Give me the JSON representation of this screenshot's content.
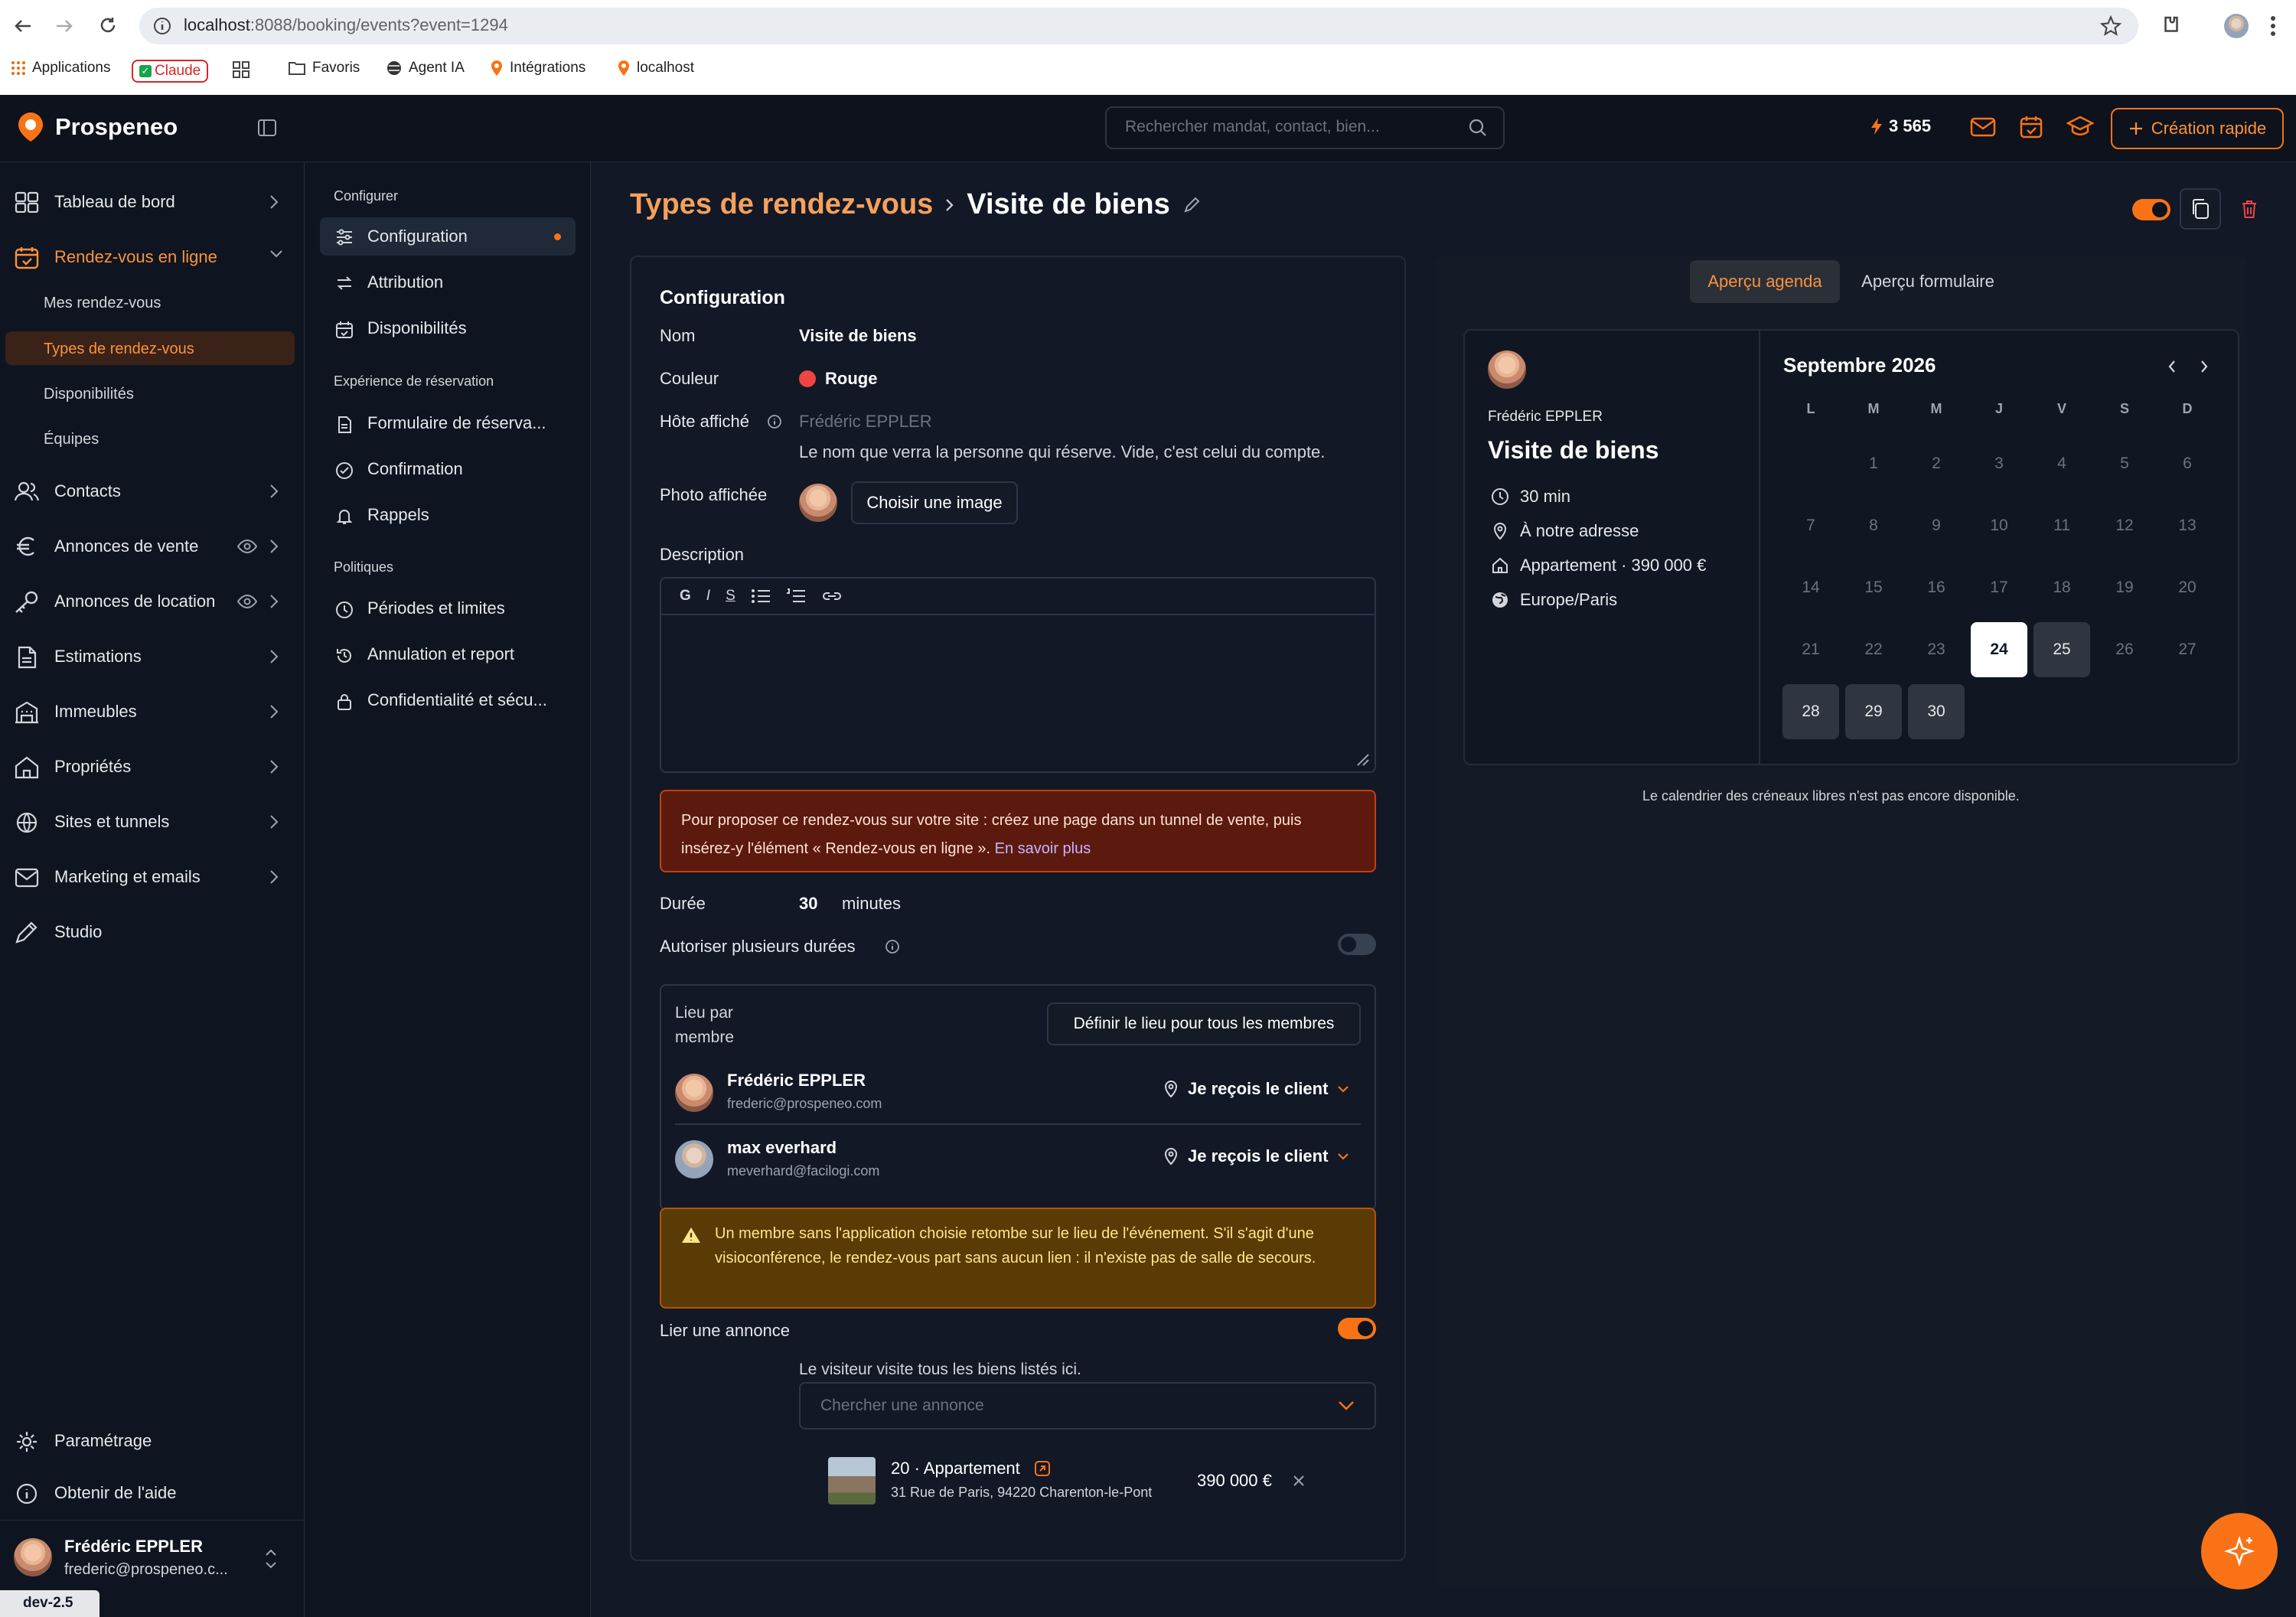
{
  "browser": {
    "url_host": "localhost",
    "url_path": ":8088/booking/events?event=1294",
    "bookmarks": [
      "Applications",
      "Claude",
      "Favoris",
      "Agent IA",
      "Intégrations",
      "localhost"
    ]
  },
  "app": {
    "name": "Prospeneo",
    "search_placeholder": "Rechercher mandat, contact, bien...",
    "credits": "3 565",
    "quick_create": "Création rapide",
    "accent": "#f97316"
  },
  "sidebar": {
    "items": [
      {
        "label": "Tableau de bord",
        "icon": "dashboard-icon"
      },
      {
        "label": "Rendez-vous en ligne",
        "icon": "calendar-icon"
      },
      {
        "label": "Contacts",
        "icon": "contacts-icon"
      },
      {
        "label": "Annonces de vente",
        "icon": "euro-icon"
      },
      {
        "label": "Annonces de location",
        "icon": "key-icon"
      },
      {
        "label": "Estimations",
        "icon": "document-icon"
      },
      {
        "label": "Immeubles",
        "icon": "building-icon"
      },
      {
        "label": "Propriétés",
        "icon": "home-icon"
      },
      {
        "label": "Sites et tunnels",
        "icon": "globe-icon"
      },
      {
        "label": "Marketing et emails",
        "icon": "mail-icon"
      },
      {
        "label": "Studio",
        "icon": "pen-icon"
      }
    ],
    "subitems": [
      "Mes rendez-vous",
      "Types de rendez-vous",
      "Disponibilités",
      "Équipes"
    ],
    "settings": "Paramétrage",
    "help": "Obtenir de l'aide",
    "user_name": "Frédéric EPPLER",
    "user_email": "frederic@prospeneo.c...",
    "version": "dev-2.5"
  },
  "subnav": {
    "section1": "Configurer",
    "section2": "Expérience de réservation",
    "section3": "Politiques",
    "items": [
      "Configuration",
      "Attribution",
      "Disponibilités",
      "Formulaire de réserva...",
      "Confirmation",
      "Rappels",
      "Périodes et limites",
      "Annulation et report",
      "Confidentialité et sécu..."
    ]
  },
  "breadcrumb": {
    "parent": "Types de rendez-vous",
    "current": "Visite de biens"
  },
  "config": {
    "title": "Configuration",
    "name_label": "Nom",
    "name_value": "Visite de biens",
    "color_label": "Couleur",
    "color_value": "Rouge",
    "color_hex": "#ef4444",
    "host_label": "Hôte affiché",
    "host_placeholder": "Frédéric EPPLER",
    "host_help": "Le nom que verra la personne qui réserve. Vide, c'est celui du compte.",
    "photo_label": "Photo affichée",
    "photo_button": "Choisir une image",
    "description_label": "Description",
    "editor_buttons": [
      "G",
      "I",
      "S"
    ],
    "alert_text": "Pour proposer ce rendez-vous sur votre site : créez une page dans un tunnel de vente, puis insérez-y l'élément « Rendez-vous en ligne ».",
    "alert_link": "En savoir plus",
    "duration_label": "Durée",
    "duration_value": "30",
    "duration_unit": "minutes",
    "multi_duration_label": "Autoriser plusieurs durées",
    "multi_duration_on": false,
    "location_label": "Lieu par membre",
    "location_button": "Définir le lieu pour tous les membres",
    "members": [
      {
        "name": "Frédéric EPPLER",
        "email": "frederic@prospeneo.com",
        "option": "Je reçois le client"
      },
      {
        "name": "max everhard",
        "email": "meverhard@facilogi.com",
        "option": "Je reçois le client"
      }
    ],
    "warning": "Un membre sans l'application choisie retombe sur le lieu de l'événement. S'il s'agit d'une visioconférence, le rendez-vous part sans aucun lien : il n'existe pas de salle de secours.",
    "link_listing_label": "Lier une annonce",
    "link_listing_on": true,
    "listing_help": "Le visiteur visite tous les biens listés ici.",
    "listing_placeholder": "Chercher une annonce",
    "listing": {
      "title": "20 · Appartement",
      "address": "31 Rue de Paris, 94220 Charenton-le-Pont",
      "price": "390 000 €"
    }
  },
  "preview": {
    "tab_agenda": "Aperçu agenda",
    "tab_form": "Aperçu formulaire",
    "host": "Frédéric EPPLER",
    "title": "Visite de biens",
    "duration": "30 min",
    "location": "À notre adresse",
    "property": "Appartement · 390 000 €",
    "timezone": "Europe/Paris",
    "month": "Septembre 2026",
    "weekdays": [
      "L",
      "M",
      "M",
      "J",
      "V",
      "S",
      "D"
    ],
    "selected_day": "24",
    "available_days": [
      "25",
      "28",
      "29",
      "30"
    ],
    "note": "Le calendrier des créneaux libres n'est pas encore disponible."
  }
}
